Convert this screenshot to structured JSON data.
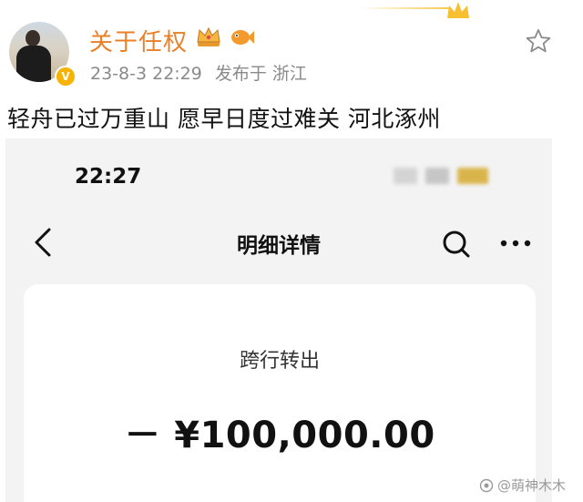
{
  "post": {
    "username": "关于任权",
    "date": "23-8-3 22:29",
    "source": "发布于 浙江",
    "text": "轻舟已过万重山 愿早日度过难关 河北涿州",
    "verified_mark": "V"
  },
  "screenshot": {
    "status_time": "22:27",
    "nav_title": "明细详情",
    "transaction_type": "跨行转出",
    "amount": "－ ¥100,000.00"
  },
  "watermark": "@萌神木木",
  "colors": {
    "username": "#e9802a",
    "verified": "#f6b400",
    "meta": "#8a8a8a"
  },
  "icons": [
    "crown-badge-icon",
    "fish-badge-icon",
    "star-icon",
    "back-arrow-icon",
    "search-icon",
    "more-icon"
  ]
}
